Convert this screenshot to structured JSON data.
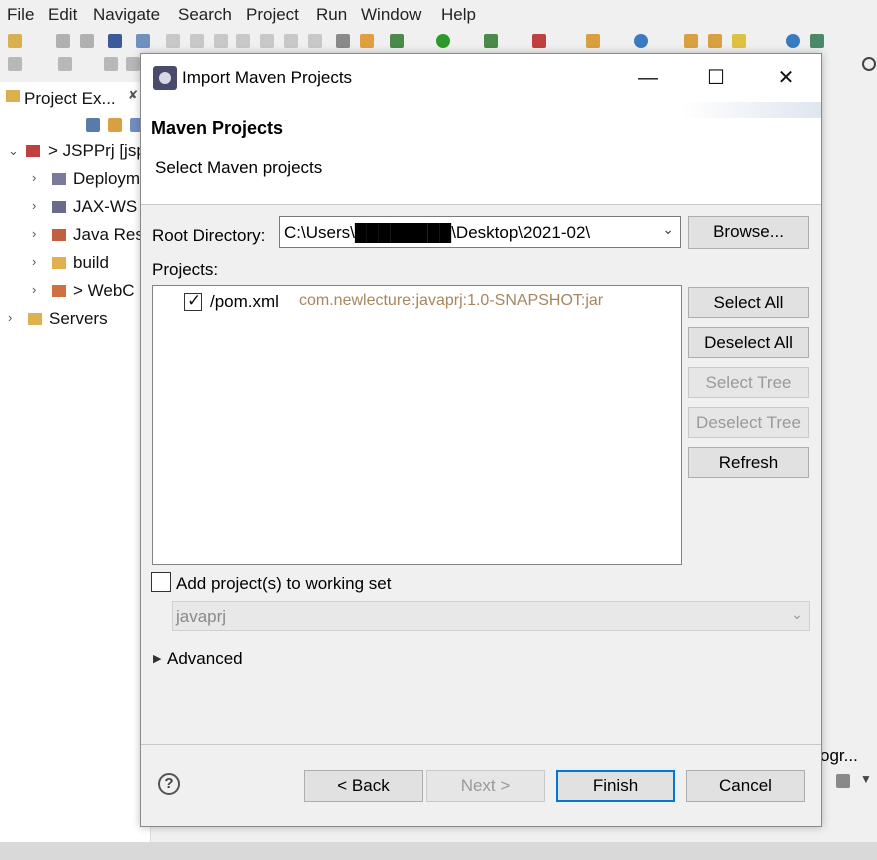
{
  "menubar": {
    "items": [
      "File",
      "Edit",
      "Navigate",
      "Search",
      "Project",
      "Run",
      "Window",
      "Help"
    ]
  },
  "explorer": {
    "tab_label": "Project Ex...",
    "tab_close": "✘",
    "items": [
      {
        "label": "> JSPPrj [jsp",
        "indent": 0
      },
      {
        "label": "Deploym",
        "indent": 1
      },
      {
        "label": "JAX-WS",
        "indent": 1
      },
      {
        "label": "Java Res",
        "indent": 1
      },
      {
        "label": "build",
        "indent": 1
      },
      {
        "label": "> WebC",
        "indent": 1
      },
      {
        "label": "Servers",
        "indent": 0
      }
    ]
  },
  "right_panel": {
    "partial_label": "ogr..."
  },
  "dialog": {
    "title": "Import Maven Projects",
    "window_buttons": {
      "minimize": "—",
      "maximize": "☐",
      "close": "✕"
    },
    "header": {
      "title": "Maven Projects",
      "description": "Select Maven projects"
    },
    "root_directory": {
      "label": "Root Directory:",
      "value": "C:\\Users\\████████\\Desktop\\2021-02\\"
    },
    "browse_button": "Browse...",
    "projects_label": "Projects:",
    "projects": [
      {
        "checked": true,
        "name": "/pom.xml",
        "artifact": "com.newlecture:javaprj:1.0-SNAPSHOT:jar"
      }
    ],
    "side_buttons": [
      {
        "label": "Select All",
        "enabled": true
      },
      {
        "label": "Deselect All",
        "enabled": true
      },
      {
        "label": "Select Tree",
        "enabled": false
      },
      {
        "label": "Deselect Tree",
        "enabled": false
      },
      {
        "label": "Refresh",
        "enabled": true
      }
    ],
    "working_set": {
      "checked": false,
      "label": "Add project(s) to working set",
      "value": "javaprj"
    },
    "advanced_label": "Advanced",
    "help_symbol": "?",
    "footer_buttons": {
      "back": "< Back",
      "next": "Next >",
      "finish": "Finish",
      "cancel": "Cancel"
    }
  }
}
